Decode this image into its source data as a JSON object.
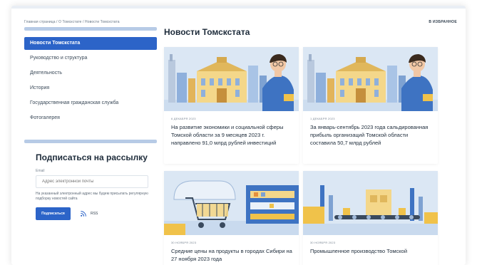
{
  "breadcrumb": "Главная страница / О Томскстате / Новости Томскстата",
  "favorites_label": "В ИЗБРАННОЕ",
  "sidebar": {
    "items": [
      {
        "label": "Новости Томскстата",
        "active": true
      },
      {
        "label": "Руководство и структура",
        "active": false
      },
      {
        "label": "Деятельность",
        "active": false
      },
      {
        "label": "История",
        "active": false
      },
      {
        "label": "Государственная гражданская служба",
        "active": false
      },
      {
        "label": "Фотогалерея",
        "active": false
      }
    ]
  },
  "subscribe": {
    "title": "Подписаться на рассылку",
    "email_label": "Email",
    "email_placeholder": "Адрес электронной почты",
    "note": "На указанный электронный адрес мы будем присылать регулярную подборку новостей сайта",
    "button_label": "Подписаться",
    "rss_label": "RSS"
  },
  "main": {
    "title": "Новости Томскстата",
    "news": [
      {
        "date": "6 ДЕКАБРЯ 2023",
        "title": "На развитие экономики и социальной сферы Томской области за 9 месяцев 2023 г. направлено 91,0 млрд рублей инвестиций"
      },
      {
        "date": "1 ДЕКАБРЯ 2023",
        "title": "За январь-сентябрь 2023 года сальдированная прибыль организаций Томской области составила 50,7 млрд рублей"
      },
      {
        "date": "30 НОЯБРЯ 2023",
        "title": "Средние цены на продукты в городах Сибири на 27 ноября 2023 года"
      },
      {
        "date": "30 НОЯБРЯ 2023",
        "title": "Промышленное производство Томской"
      }
    ]
  },
  "colors": {
    "accent": "#2c64c8",
    "sidebar_line": "#b7cbe6",
    "illustration_bg": "#dbe7f4"
  }
}
